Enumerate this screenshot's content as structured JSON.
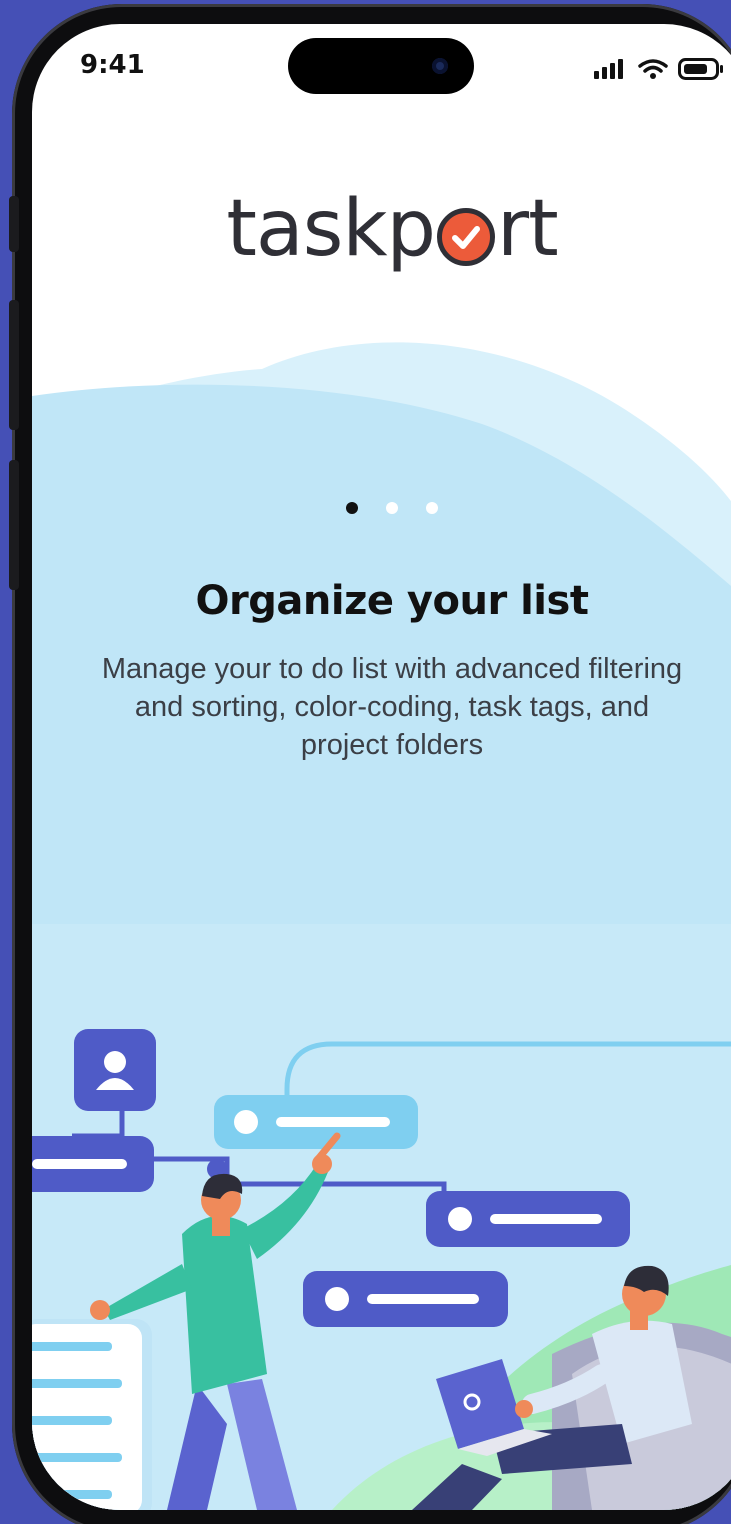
{
  "status_bar": {
    "time": "9:41"
  },
  "logo": {
    "part1": "taskp",
    "part2": "rt"
  },
  "pager": {
    "total": 3,
    "active_index": 0
  },
  "onboarding": {
    "title": "Organize your list",
    "description": "Manage your to do list with advanced filtering and sorting, color-coding, task tags, and project folders"
  },
  "colors": {
    "background": "#4550b6",
    "accent": "#ec5b3a",
    "sky": "#c3e8f8",
    "card_blue": "#4f5bc7",
    "card_light": "#7fcff0"
  },
  "icons": [
    "signal-icon",
    "wifi-icon",
    "battery-icon",
    "user-icon",
    "checkmark-icon"
  ]
}
